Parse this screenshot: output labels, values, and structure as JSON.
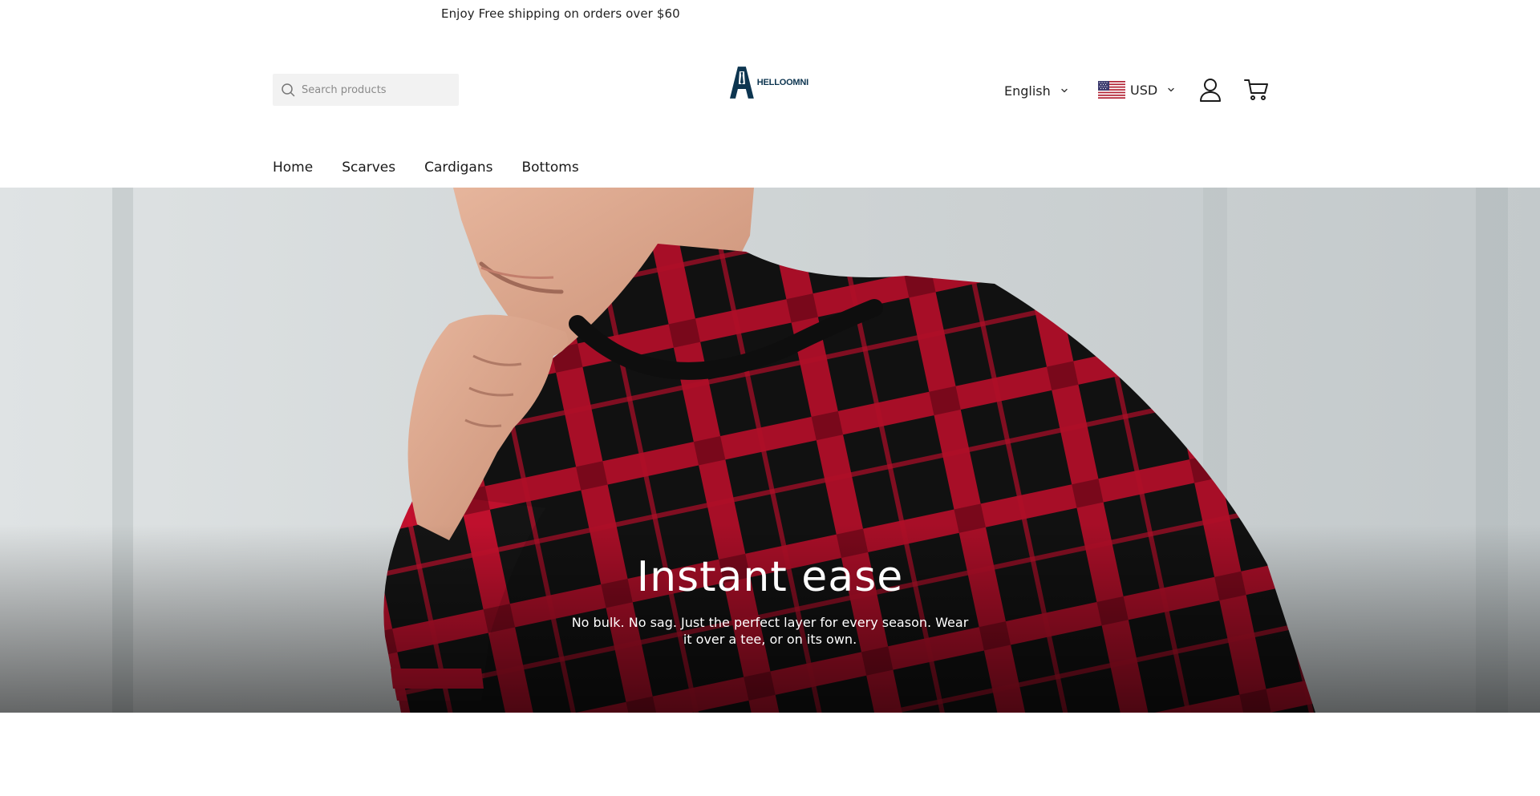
{
  "announcement": {
    "text": "Enjoy Free shipping on orders over $60"
  },
  "header": {
    "search": {
      "placeholder": "Search products",
      "value": ""
    },
    "logo": {
      "text": "HELLOOMNI"
    },
    "language": {
      "selected": "English"
    },
    "currency": {
      "selected": "USD"
    }
  },
  "nav": {
    "items": [
      {
        "label": "Home"
      },
      {
        "label": "Scarves"
      },
      {
        "label": "Cardigans"
      },
      {
        "label": "Bottoms"
      }
    ]
  },
  "hero": {
    "title": "Instant ease",
    "subtitle": "No bulk. No sag. Just the perfect layer for every season. Wear it over a tee, or on its own."
  },
  "colors": {
    "brand": "#0d3550",
    "text": "#1a1a1a",
    "search_bg": "#f2f2f2",
    "hero_bg": "#d5d9da",
    "sweater_red": "#c8102e",
    "sweater_black": "#141414"
  },
  "icons": {
    "search": "search-icon",
    "language_chevron": "chevron-down-icon",
    "currency_flag": "us-flag-icon",
    "account": "user-icon",
    "cart": "cart-icon"
  }
}
